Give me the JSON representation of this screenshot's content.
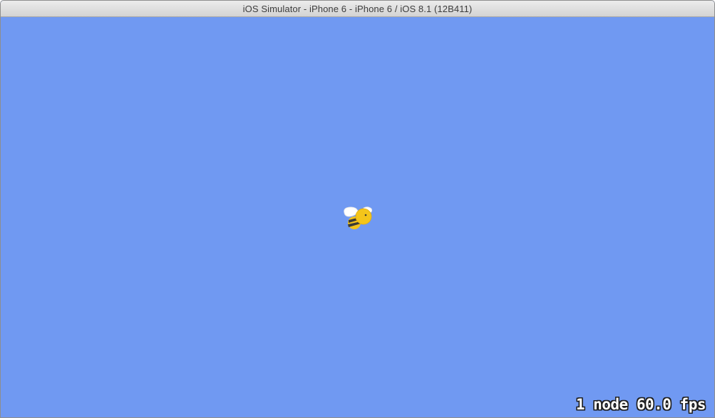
{
  "window": {
    "title": "iOS Simulator - iPhone 6 - iPhone 6 / iOS 8.1 (12B411)"
  },
  "scene": {
    "background_color": "#7099f2",
    "sprite": {
      "name": "bee",
      "icon": "bee-icon"
    },
    "stats": {
      "label": "1 node 60.0 fps"
    }
  },
  "colors": {
    "bee_body": "#f2c21b",
    "bee_stripe": "#3b3a35",
    "wing": "#ffffff"
  }
}
